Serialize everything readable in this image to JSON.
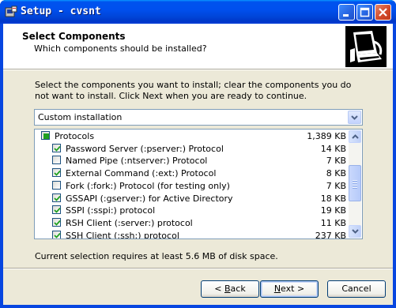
{
  "window": {
    "title": "Setup - cvsnt",
    "title_bar_color": "#0053ee",
    "controls": [
      "minimize-icon",
      "maximize-icon",
      "close-icon"
    ]
  },
  "header": {
    "title": "Select Components",
    "subtitle": "Which components should be installed?"
  },
  "body": {
    "description": "Select the components you want to install; clear the components you do not want to install. Click Next when you are ready to continue."
  },
  "install_type": {
    "selected": "Custom installation"
  },
  "components": [
    {
      "label": "Protocols",
      "size": "1,389 KB",
      "state": "partial",
      "level": 0
    },
    {
      "label": "Password Server (:pserver:) Protocol",
      "size": "14 KB",
      "state": "checked",
      "level": 1
    },
    {
      "label": "Named Pipe (:ntserver:) Protocol",
      "size": "7 KB",
      "state": "unchecked",
      "level": 1
    },
    {
      "label": "External Command (:ext:) Protocol",
      "size": "8 KB",
      "state": "checked",
      "level": 1
    },
    {
      "label": "Fork (:fork:) Protocol (for testing only)",
      "size": "7 KB",
      "state": "unchecked",
      "level": 1
    },
    {
      "label": "GSSAPI (:gserver:) for Active Directory",
      "size": "18 KB",
      "state": "checked",
      "level": 1
    },
    {
      "label": "SSPI (:sspi:) protocol",
      "size": "19 KB",
      "state": "checked",
      "level": 1
    },
    {
      "label": "RSH Client (:server:) protocol",
      "size": "11 KB",
      "state": "checked",
      "level": 1
    },
    {
      "label": "SSH Client (:ssh:) protocol",
      "size": "237 KB",
      "state": "checked",
      "level": 1
    }
  ],
  "status": {
    "disk_space": "Current selection requires at least 5.6 MB of disk space."
  },
  "buttons": {
    "back_prefix": "< ",
    "back_mnemonic": "B",
    "back_rest": "ack",
    "next_mnemonic": "N",
    "next_rest": "ext >",
    "cancel": "Cancel"
  },
  "colors": {
    "checkbox_tick": "#21a121",
    "partial_fill": "#21a121",
    "dialog_bg": "#ece9d8"
  }
}
